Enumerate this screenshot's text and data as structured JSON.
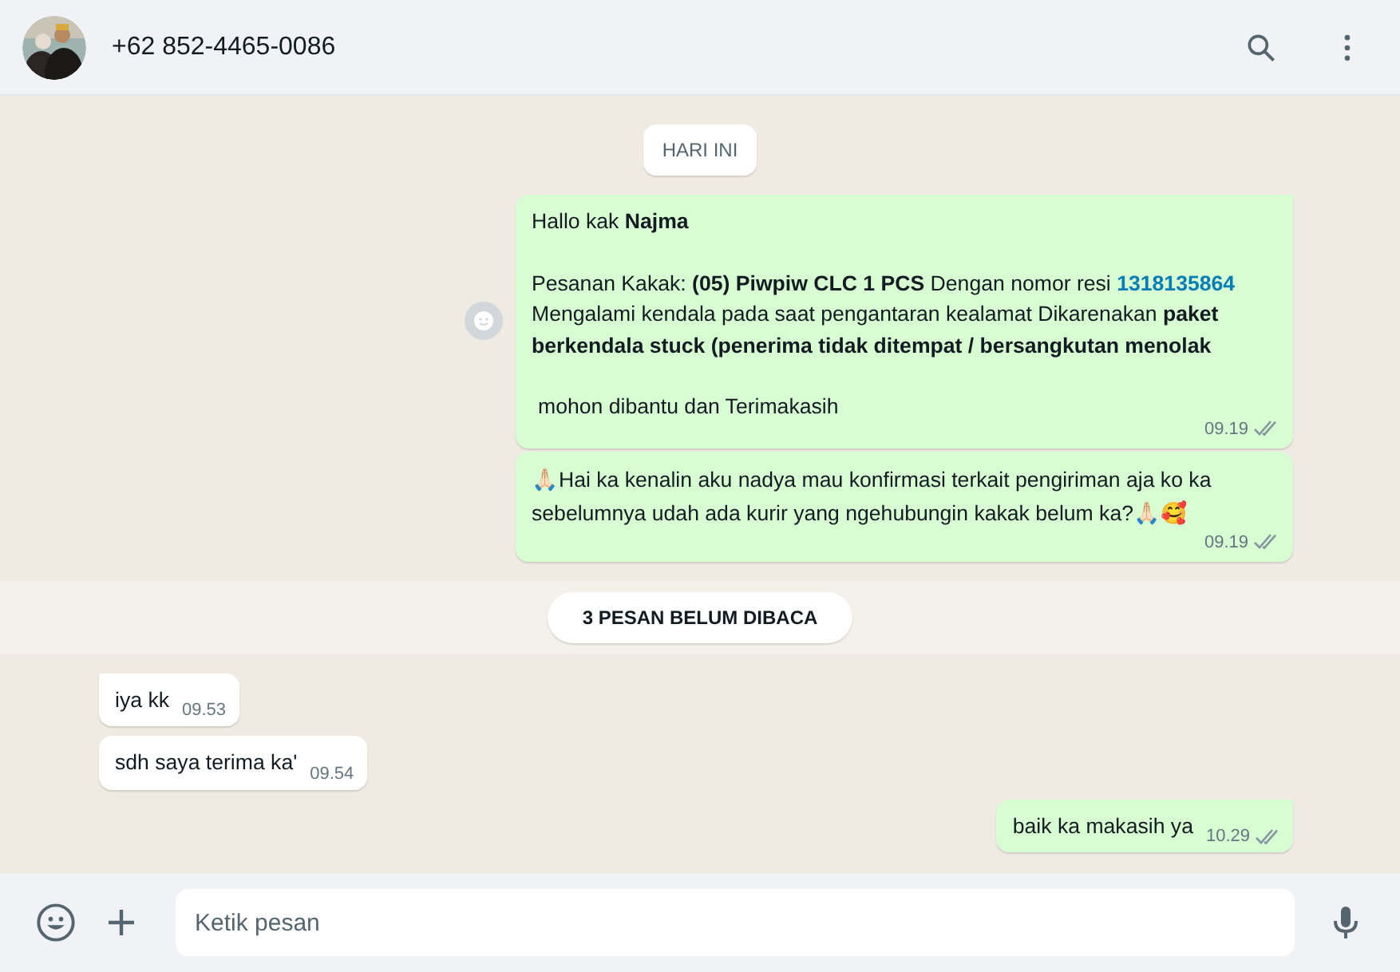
{
  "header": {
    "contact": "+62 852-4465-0086"
  },
  "date_pill": "HARI INI",
  "messages": [
    {
      "kind": "order",
      "outgoing": true,
      "greeting": "Hallo kak **Najma**",
      "body_before": "Pesanan Kakak: **(05) Piwpiw CLC 1 PCS** Dengan nomor resi ",
      "link": "1318135864",
      "body_after": " Mengalami kendala pada saat pengantaran kealamat Dikarenakan **paket berkendala stuck (penerima tidak ditempat / bersangkutan menolak**",
      "closing": "mohon dibantu dan Terimakasih",
      "time": "09.19",
      "read": false
    },
    {
      "kind": "emoji",
      "outgoing": true,
      "text": "🙏🏻Hai ka kenalin aku nadya mau konfirmasi terkait pengiriman aja ko ka sebelumnya udah ada kurir yang ngehubungin kakak belum ka?🙏🏻🥰",
      "time": "09.19",
      "read": false
    },
    {
      "kind": "unread",
      "text": "3 PESAN BELUM DIBACA"
    },
    {
      "kind": "plain",
      "outgoing": false,
      "text": "iya kk",
      "time": "09.53"
    },
    {
      "kind": "plain",
      "outgoing": false,
      "text": "sdh saya terima ka'",
      "time": "09.54"
    },
    {
      "kind": "plain",
      "outgoing": true,
      "text": "baik ka makasih ya",
      "time": "10.29",
      "read": false
    }
  ],
  "composer": {
    "placeholder": "Ketik pesan"
  }
}
